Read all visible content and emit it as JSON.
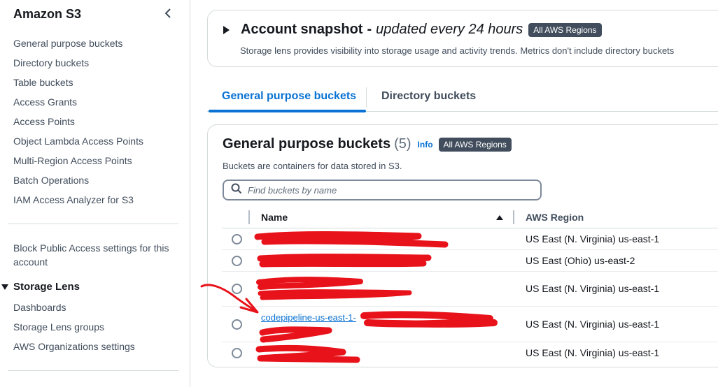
{
  "sidebar": {
    "title": "Amazon S3",
    "items": [
      {
        "label": "General purpose buckets"
      },
      {
        "label": "Directory buckets"
      },
      {
        "label": "Table buckets"
      },
      {
        "label": "Access Grants"
      },
      {
        "label": "Access Points"
      },
      {
        "label": "Object Lambda Access Points"
      },
      {
        "label": "Multi-Region Access Points"
      },
      {
        "label": "Batch Operations"
      },
      {
        "label": "IAM Access Analyzer for S3"
      }
    ],
    "block_public_access": "Block Public Access settings for this account",
    "storage_lens": {
      "label": "Storage Lens",
      "items": [
        {
          "label": "Dashboards"
        },
        {
          "label": "Storage Lens groups"
        },
        {
          "label": "AWS Organizations settings"
        }
      ]
    }
  },
  "snapshot": {
    "title": "Account snapshot",
    "separator": "-",
    "subtitle": "updated every 24 hours",
    "badge": "All AWS Regions",
    "description": "Storage lens provides visibility into storage usage and activity trends. Metrics don't include directory buckets"
  },
  "tabs": [
    {
      "label": "General purpose buckets",
      "active": true
    },
    {
      "label": "Directory buckets",
      "active": false
    }
  ],
  "buckets": {
    "title": "General purpose buckets",
    "count": "(5)",
    "info": "Info",
    "badge": "All AWS Regions",
    "description": "Buckets are containers for data stored in S3.",
    "search_placeholder": "Find buckets by name",
    "columns": {
      "name": "Name",
      "region": "AWS Region"
    },
    "rows": [
      {
        "name": "",
        "region": "US East (N. Virginia) us-east-1"
      },
      {
        "name": "",
        "region": "US East (Ohio) us-east-2"
      },
      {
        "name": "",
        "region": "US East (N. Virginia) us-east-1"
      },
      {
        "name": "codepipeline-us-east-1-",
        "region": "US East (N. Virginia) us-east-1"
      },
      {
        "name": "",
        "region": "US East (N. Virginia) us-east-1"
      }
    ]
  },
  "colors": {
    "link": "#0972d3",
    "badge_bg": "#414d5c",
    "redaction": "#e8121a"
  }
}
